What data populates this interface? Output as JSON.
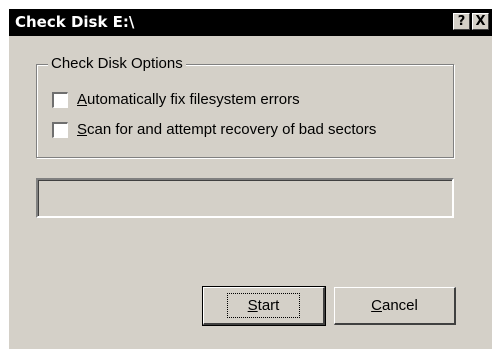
{
  "window": {
    "title": "Check Disk E:\\",
    "help_glyph": "?",
    "close_glyph": "X"
  },
  "options_group": {
    "label": "Check Disk Options",
    "options": [
      {
        "mnemonic": "A",
        "rest": "utomatically fix filesystem errors",
        "checked": false
      },
      {
        "mnemonic": "S",
        "rest": "can for and attempt recovery of bad sectors",
        "checked": false
      }
    ]
  },
  "progress": {
    "value": 0
  },
  "buttons": {
    "start": {
      "mnemonic": "S",
      "rest": "tart",
      "default": true
    },
    "cancel": {
      "mnemonic": "C",
      "rest": "ancel"
    }
  }
}
